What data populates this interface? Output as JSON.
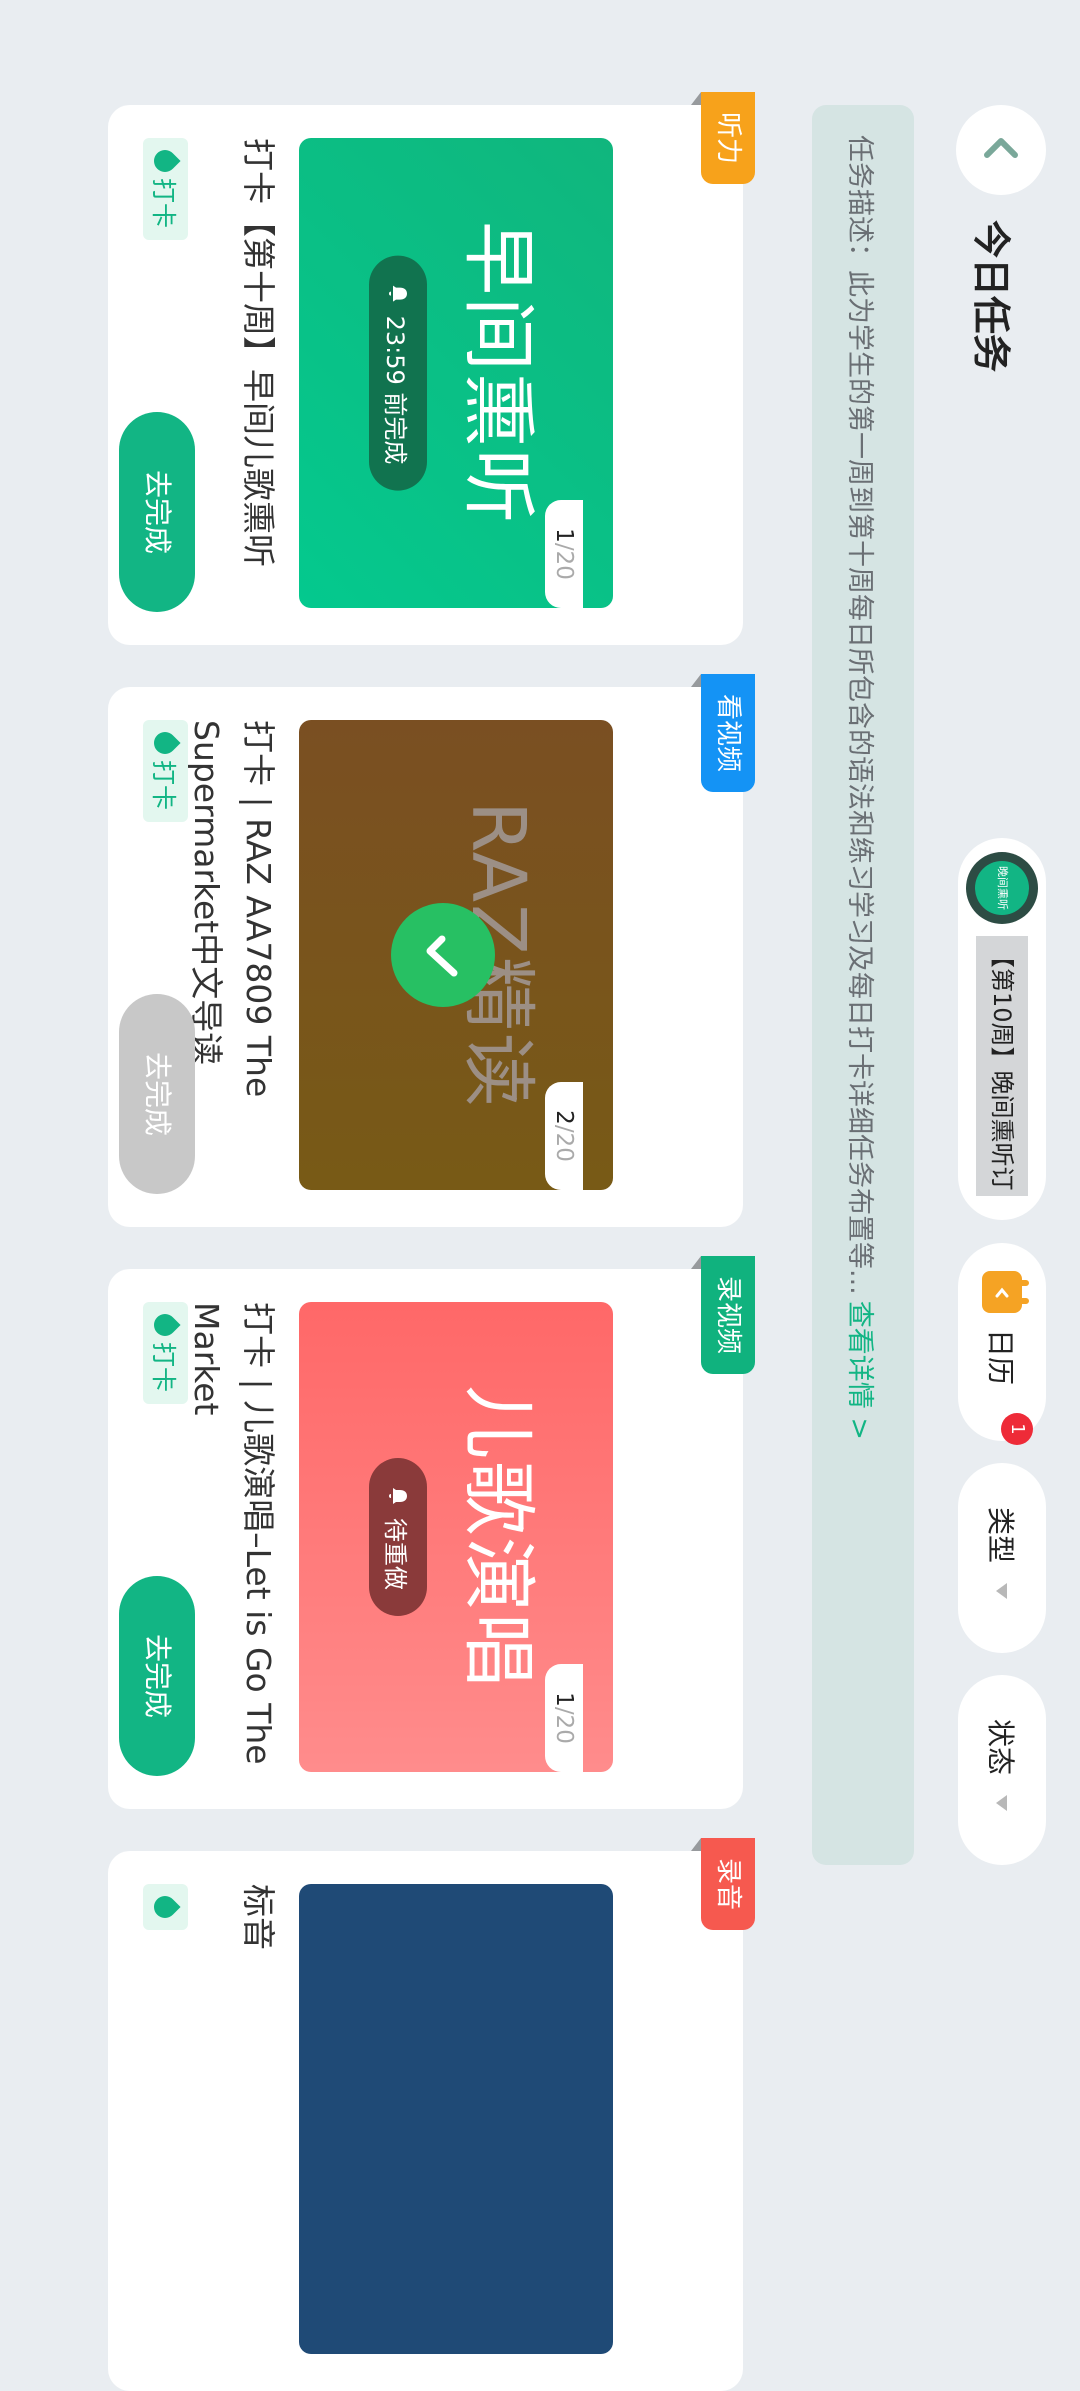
{
  "header": {
    "title": "今日任务",
    "week_logo_text": "晚间熏听",
    "week_label": "【第10周】晚间熏听订",
    "calendar_label": "日历",
    "calendar_badge": "1",
    "type_label": "类型",
    "state_label": "状态"
  },
  "description": {
    "text": "任务描述：此为学生的第一周到第十周每日所包含的语法和练习学习及每日打卡详细任务布置等...",
    "link": "查看详情 >"
  },
  "cards": [
    {
      "tag": "听力",
      "tag_color": "#f7a21b",
      "count_current": "1",
      "count_total": "/20",
      "thumb_title": "早间熏听",
      "status": "23:59 前完成",
      "title": "打卡【第十周】早间儿歌熏听",
      "clock_label": "打卡",
      "action": "去完成",
      "action_enabled": true
    },
    {
      "tag": "看视频",
      "tag_color": "#1493f5",
      "count_current": "2",
      "count_total": "/20",
      "thumb_title": "RAZ精读",
      "status": "",
      "title": "打卡 | RAZ AA7809 The Supermarket中文导读",
      "clock_label": "打卡",
      "action": "去完成",
      "action_enabled": false
    },
    {
      "tag": "录视频",
      "tag_color": "#10b27e",
      "count_current": "1",
      "count_total": "/20",
      "thumb_title": "儿歌演唱",
      "status": "待重做",
      "title": "打卡 | 儿歌演唱–Let is Go The Market",
      "clock_label": "打卡",
      "action": "去完成",
      "action_enabled": true
    },
    {
      "tag": "录音",
      "tag_color": "#f6594f",
      "title": "标音"
    }
  ],
  "colors": {
    "accent": "#12b584",
    "background": "#e9edf1",
    "disabled": "#c8c8c8"
  }
}
